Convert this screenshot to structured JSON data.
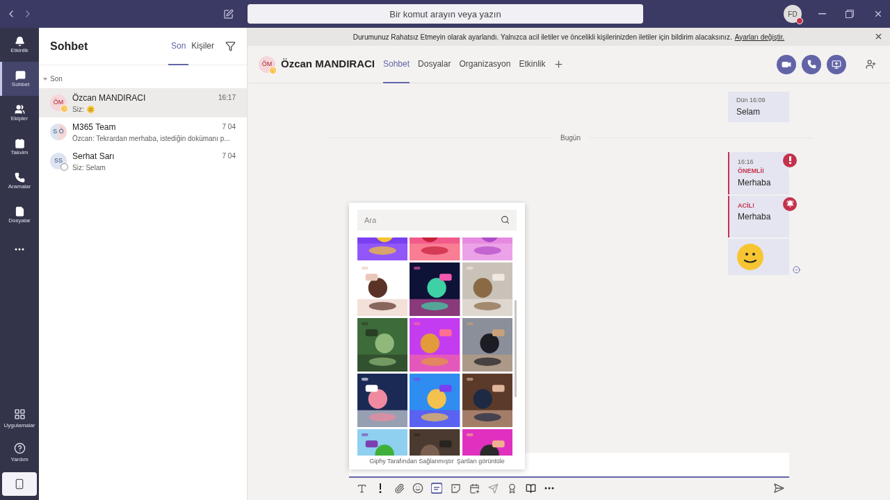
{
  "top_bar": {
    "search_placeholder": "Bir komut arayın veya yazın",
    "user_initials": "FD",
    "busy": true
  },
  "rail": [
    {
      "kind": "bell",
      "label": "Etkinlik",
      "selected": false
    },
    {
      "kind": "chat",
      "label": "Sohbet",
      "selected": true
    },
    {
      "kind": "teams",
      "label": "Ekipler",
      "selected": false
    },
    {
      "kind": "calendar",
      "label": "Takvim",
      "selected": false
    },
    {
      "kind": "calls",
      "label": "Aramalar",
      "selected": false
    },
    {
      "kind": "files",
      "label": "Dosyalar",
      "selected": false
    },
    {
      "kind": "more",
      "selected": false
    }
  ],
  "rail_bottom": [
    {
      "kind": "apps",
      "label": "Uygulamalar"
    },
    {
      "kind": "help",
      "label": "Yardım"
    }
  ],
  "chat_list": {
    "title": "Sohbet",
    "tabs": [
      {
        "label": "Son",
        "selected": true
      },
      {
        "label": "Kişiler",
        "selected": false
      }
    ],
    "section": "Son",
    "items": [
      {
        "initials": "ÖM",
        "split": false,
        "away": true,
        "offline": false,
        "name": "Özcan MANDIRACI",
        "time": "16:17",
        "preview": "Siz:",
        "preview_emoji": true,
        "selected": true
      },
      {
        "initials": "S Ö",
        "split": true,
        "away": false,
        "offline": false,
        "name": "M365 Team",
        "time": "7 04",
        "preview": "Özcan: Tekrardan merhaba, istediğin dokümanı p...",
        "preview_emoji": false,
        "selected": false
      },
      {
        "initials": "SS",
        "split": false,
        "away": false,
        "offline": true,
        "name": "Serhat Sarı",
        "time": "7 04",
        "preview": "Siz: Selam",
        "preview_emoji": false,
        "selected": false
      }
    ]
  },
  "banner": {
    "text": "Durumunuz Rahatsız Etmeyin olarak ayarlandı. Yalnızca acil iletiler ve öncelikli kişilerinizden iletiler için bildirim alacaksınız.",
    "link": "Ayarları değiştir."
  },
  "conversation": {
    "initials": "ÖM",
    "away": true,
    "name": "Özcan MANDIRACI",
    "tabs": [
      {
        "label": "Sohbet",
        "selected": true
      },
      {
        "label": "Dosyalar",
        "selected": false
      },
      {
        "label": "Organizasyon",
        "selected": false
      },
      {
        "label": "Etkinlik",
        "selected": false
      }
    ]
  },
  "messages": [
    {
      "kind": "plain",
      "time": "Dün 16:09",
      "text": "Selam"
    },
    {
      "kind": "divider",
      "text": "Bugün"
    },
    {
      "kind": "important",
      "time": "16:16",
      "label": "ÖNEMLİ!",
      "text": "Merhaba"
    },
    {
      "kind": "urgent",
      "label": "ACİL!",
      "text": "Merhaba"
    },
    {
      "kind": "emoji",
      "seen": true
    }
  ],
  "gif_picker": {
    "placeholder": "Ara",
    "credit": "Giphy Tarafından Sağlanmıştır",
    "terms_link": "Şartları görüntüle"
  },
  "composer_tools": [
    {
      "kind": "format",
      "selected": false
    },
    {
      "kind": "important",
      "selected": false
    },
    {
      "kind": "attach",
      "selected": false
    },
    {
      "kind": "emoji",
      "selected": false
    },
    {
      "kind": "gif",
      "selected": true
    },
    {
      "kind": "sticker",
      "selected": false
    },
    {
      "kind": "meeting",
      "selected": false
    },
    {
      "kind": "stream",
      "selected": false
    },
    {
      "kind": "praise",
      "selected": false
    },
    {
      "kind": "board",
      "selected": false
    },
    {
      "kind": "more",
      "selected": false
    }
  ]
}
